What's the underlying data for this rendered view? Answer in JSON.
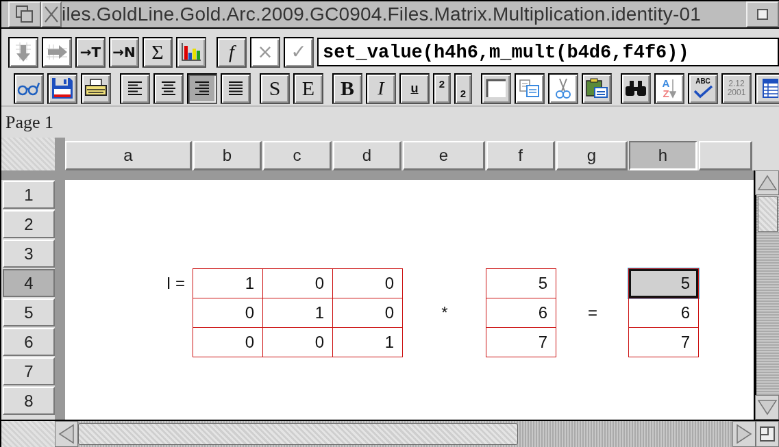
{
  "window": {
    "title": "iles.GoldLine.Gold.Arc.2009.GC0904.Files.Matrix.Multiplication.identity-01"
  },
  "formula_bar": {
    "buttons": [
      {
        "kind": "fill-down",
        "disabled": true
      },
      {
        "kind": "fill-right",
        "disabled": true
      },
      {
        "kind": "text",
        "label": "→T",
        "disabled": false
      },
      {
        "kind": "text",
        "label": "→N",
        "disabled": false
      },
      {
        "kind": "serif",
        "label": "Σ",
        "disabled": false
      },
      {
        "kind": "chart",
        "disabled": false
      },
      {
        "kind": "italic",
        "label": "f",
        "disabled": false
      },
      {
        "kind": "cancel",
        "label": "×",
        "disabled": true
      },
      {
        "kind": "confirm",
        "label": "✓",
        "disabled": true
      }
    ],
    "formula": "set_value(h4h6,m_mult(b4d6,f4f6))"
  },
  "toolbar": [
    {
      "kind": "view"
    },
    {
      "kind": "save"
    },
    {
      "kind": "print"
    },
    {
      "kind": "align-left",
      "selected": false
    },
    {
      "kind": "align-center",
      "selected": false
    },
    {
      "kind": "align-right",
      "selected": true
    },
    {
      "kind": "justify",
      "selected": false
    },
    {
      "kind": "serif",
      "label": "S"
    },
    {
      "kind": "serif",
      "label": "E"
    },
    {
      "kind": "bold",
      "label": "B"
    },
    {
      "kind": "italic",
      "label": "I"
    },
    {
      "kind": "underline",
      "label": "u"
    },
    {
      "kind": "superscript",
      "label": "2"
    },
    {
      "kind": "subscript",
      "label": "2"
    },
    {
      "kind": "border"
    },
    {
      "kind": "copy"
    },
    {
      "kind": "cut"
    },
    {
      "kind": "paste"
    },
    {
      "kind": "find"
    },
    {
      "kind": "sort",
      "lines": [
        "A",
        "Z"
      ]
    },
    {
      "kind": "spell",
      "lines": [
        "ABC"
      ]
    },
    {
      "kind": "date",
      "lines": [
        "2.12",
        "2001"
      ]
    },
    {
      "kind": "table"
    }
  ],
  "page_label": "Page 1",
  "columns": [
    {
      "label": "a",
      "selected": false
    },
    {
      "label": "b",
      "selected": false
    },
    {
      "label": "c",
      "selected": false
    },
    {
      "label": "d",
      "selected": false
    },
    {
      "label": "e",
      "selected": false
    },
    {
      "label": "f",
      "selected": false
    },
    {
      "label": "g",
      "selected": false
    },
    {
      "label": "h",
      "selected": true
    }
  ],
  "rows": [
    {
      "label": "1",
      "selected": false
    },
    {
      "label": "2",
      "selected": false
    },
    {
      "label": "3",
      "selected": false
    },
    {
      "label": "4",
      "selected": true,
      "cells": [
        {
          "text": "I =",
          "boxed": false,
          "kind": "label",
          "selected": false
        },
        {
          "text": "1",
          "boxed": true,
          "kind": "number",
          "selected": false
        },
        {
          "text": "0",
          "boxed": true,
          "kind": "number",
          "selected": false
        },
        {
          "text": "0",
          "boxed": true,
          "kind": "number",
          "selected": false
        },
        null,
        {
          "text": "5",
          "boxed": true,
          "kind": "number",
          "selected": false
        },
        null,
        {
          "text": "5",
          "boxed": true,
          "kind": "number",
          "selected": true
        }
      ]
    },
    {
      "label": "5",
      "selected": false,
      "cells": [
        null,
        {
          "text": "0",
          "boxed": true,
          "kind": "number",
          "selected": false
        },
        {
          "text": "1",
          "boxed": true,
          "kind": "number",
          "selected": false
        },
        {
          "text": "0",
          "boxed": true,
          "kind": "number",
          "selected": false
        },
        {
          "text": "*",
          "boxed": false,
          "kind": "operator",
          "selected": false
        },
        {
          "text": "6",
          "boxed": true,
          "kind": "number",
          "selected": false
        },
        {
          "text": "=",
          "boxed": false,
          "kind": "operator",
          "selected": false
        },
        {
          "text": "6",
          "boxed": true,
          "kind": "number",
          "selected": false
        }
      ]
    },
    {
      "label": "6",
      "selected": false,
      "cells": [
        null,
        {
          "text": "0",
          "boxed": true,
          "kind": "number",
          "selected": false
        },
        {
          "text": "0",
          "boxed": true,
          "kind": "number",
          "selected": false
        },
        {
          "text": "1",
          "boxed": true,
          "kind": "number",
          "selected": false
        },
        null,
        {
          "text": "7",
          "boxed": true,
          "kind": "number",
          "selected": false
        },
        null,
        {
          "text": "7",
          "boxed": true,
          "kind": "number",
          "selected": false
        }
      ]
    },
    {
      "label": "7",
      "selected": false
    },
    {
      "label": "8",
      "selected": false
    }
  ]
}
